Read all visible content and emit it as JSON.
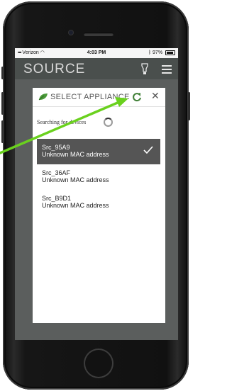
{
  "status_bar": {
    "carrier": "Verizon",
    "time": "4:03 PM",
    "battery": "97%"
  },
  "app_bar": {
    "logo": "SOURCE"
  },
  "dialog": {
    "title": "SELECT APPLIANCE",
    "close_glyph": "✕",
    "searching_label": "Searching for devices",
    "devices": [
      {
        "name": "Src_95A9",
        "mac": "Unknown MAC address",
        "selected": true
      },
      {
        "name": "Src_36AF",
        "mac": "Unknown MAC address",
        "selected": false
      },
      {
        "name": "Src_B9D1",
        "mac": "Unknown MAC address",
        "selected": false
      }
    ]
  },
  "colors": {
    "accent_green": "#4a9a3a",
    "arrow_green": "#6ad11e",
    "app_bar": "#4a4f4d",
    "selected_row": "#555555"
  },
  "icons": {
    "refresh": "refresh-icon",
    "close": "close-icon",
    "check": "checkmark-icon",
    "logo_leaf": "leaf-icon",
    "light": "lightbulb-icon",
    "menu": "hamburger-menu-icon"
  }
}
